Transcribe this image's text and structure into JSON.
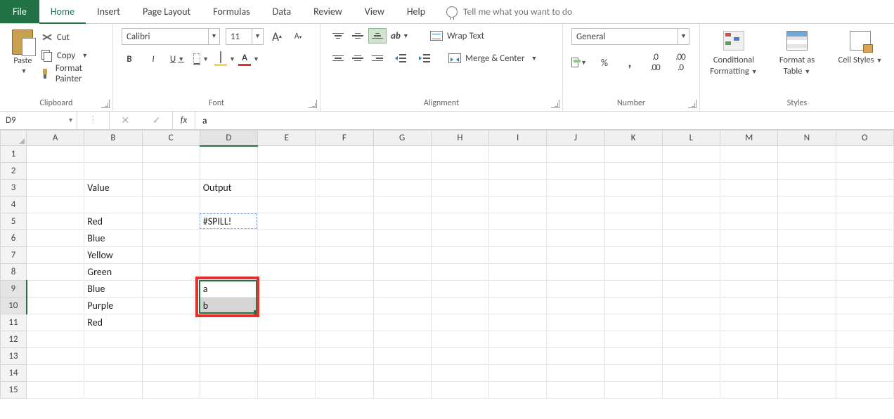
{
  "tabs": {
    "file": "File",
    "items": [
      "Home",
      "Insert",
      "Page Layout",
      "Formulas",
      "Data",
      "Review",
      "View",
      "Help"
    ],
    "active": 0,
    "tell_me_placeholder": "Tell me what you want to do"
  },
  "ribbon": {
    "clipboard": {
      "label": "Clipboard",
      "paste": "Paste",
      "cut": "Cut",
      "copy": "Copy",
      "format_painter": "Format Painter"
    },
    "font": {
      "label": "Font",
      "name": "Calibri",
      "size": "11",
      "bold": "B",
      "italic": "I",
      "underline": "U"
    },
    "alignment": {
      "label": "Alignment",
      "wrap_text": "Wrap Text",
      "merge_center": "Merge & Center"
    },
    "number": {
      "label": "Number",
      "format": "General",
      "percent": "%",
      "comma": ","
    },
    "styles": {
      "label": "Styles",
      "conditional": "Conditional Formatting",
      "format_as_table": "Format as Table",
      "cell_styles": "Cell Styles"
    }
  },
  "formula_bar": {
    "name_box": "D9",
    "fx": "fx",
    "formula": "a"
  },
  "grid": {
    "columns": [
      "A",
      "B",
      "C",
      "D",
      "E",
      "F",
      "G",
      "H",
      "I",
      "J",
      "K",
      "L",
      "M",
      "N",
      "O"
    ],
    "active_col": "D",
    "row_count": 15,
    "active_rows": [
      9,
      10
    ],
    "cells": {
      "B3": "Value",
      "D3": "Output",
      "B5": "Red",
      "D5": "#SPILL!",
      "B6": "Blue",
      "B7": "Yellow",
      "B8": "Green",
      "B9": "Blue",
      "D9": "a",
      "B10": "Purple",
      "D10": "b",
      "B11": "Red"
    },
    "selection": {
      "start": "D9",
      "end": "D10",
      "primary": "D9"
    }
  }
}
